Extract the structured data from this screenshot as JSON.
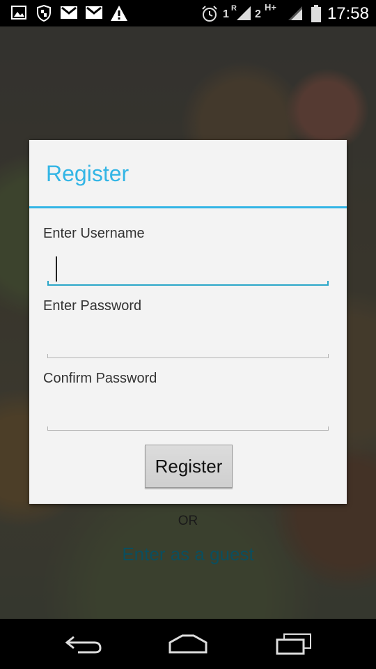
{
  "status_bar": {
    "time": "17:58",
    "sim1_label": "1",
    "sim1_network": "R",
    "sim2_label": "2",
    "sim2_network": "H+",
    "icons": [
      "image-icon",
      "shield-icon",
      "gmail-icon",
      "gmail-icon",
      "warning-icon",
      "alarm-icon",
      "signal-icon",
      "signal-icon",
      "battery-icon"
    ]
  },
  "background_screen": {
    "or_text": "OR",
    "guest_link": "Enter as a guest"
  },
  "dialog": {
    "title": "Register",
    "username_label": "Enter Username",
    "username_value": "",
    "password_label": "Enter Password",
    "password_value": "",
    "confirm_label": "Confirm Password",
    "confirm_value": "",
    "register_button": "Register"
  },
  "nav_bar": {
    "icons": [
      "back-icon",
      "home-icon",
      "recents-icon"
    ]
  },
  "colors": {
    "accent": "#33b5e5",
    "dialog_bg": "#f3f3f3",
    "link": "#0b4e5e"
  }
}
